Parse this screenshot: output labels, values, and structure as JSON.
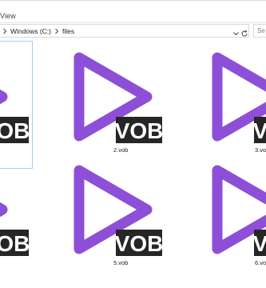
{
  "window": {
    "ribbon_tab_partial": "View"
  },
  "address_bar": {
    "path": [
      "Windows (C:)",
      "files"
    ]
  },
  "search": {
    "placeholder_partial": "Se"
  },
  "files": [
    {
      "name": "",
      "badge": "VOB"
    },
    {
      "name": "2.vob",
      "badge": "VOB"
    },
    {
      "name": "3.vob",
      "badge": "VOB"
    },
    {
      "name": "",
      "badge": "VOB"
    },
    {
      "name": "5.vob",
      "badge": "VOB"
    },
    {
      "name": "6.vob",
      "badge": "VOB"
    }
  ],
  "colors": {
    "play_icon": "#8e4fd8",
    "badge_bg": "#262626",
    "badge_text": "#ffffff",
    "selection_border": "#99d1ff"
  },
  "icons": {
    "file_icon": "play-triangle-icon",
    "breadcrumb_separator": "chevron-right-icon",
    "address_dropdown": "chevron-down-icon",
    "refresh": "refresh-icon"
  }
}
